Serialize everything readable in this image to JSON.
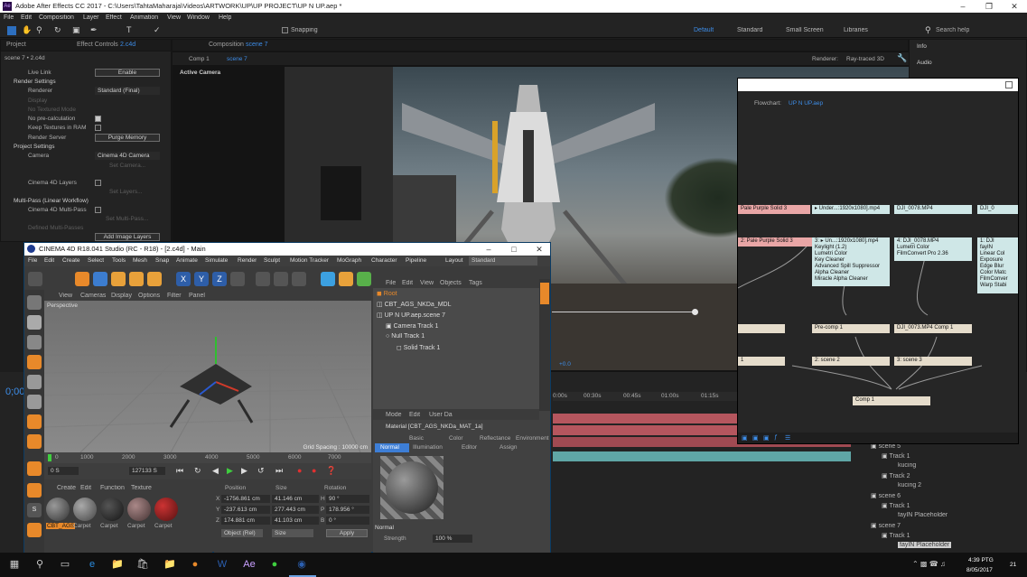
{
  "app": {
    "title": "Adobe After Effects CC 2017 - C:\\Users\\TahtaMaharaja\\Videos\\ARTWORK\\UP\\UP PROJECT\\UP N UP.aep *",
    "menu": [
      "File",
      "Edit",
      "Composition",
      "Layer",
      "Effect",
      "Animation",
      "View",
      "Window",
      "Help"
    ],
    "snapping": "Snapping",
    "workspaces": [
      "Default",
      "Standard",
      "Small Screen",
      "Libraries"
    ],
    "search_placeholder": "Search help"
  },
  "left_panel": {
    "tab_project": "Project",
    "tab_effect": "Effect Controls",
    "effect_target": "2.c4d",
    "breadcrumb": "scene 7 • 2.c4d",
    "live_link": "Live Link",
    "enable": "Enable",
    "render_settings": "Render Settings",
    "renderer": "Renderer",
    "renderer_value": "Standard (Final)",
    "display": "Display",
    "no_textured": "No Textured Mode",
    "no_precalc": "No pre-calculation",
    "keep_textures": "Keep Textures in RAM",
    "render_server": "Render Server",
    "purge_memory": "Purge Memory",
    "project_settings": "Project Settings",
    "camera": "Camera",
    "camera_value": "Cinema 4D Camera",
    "set_camera": "Set Camera...",
    "set_layers": "Set Layers...",
    "c4d_layers": "Cinema 4D Layers",
    "multipass": "Multi-Pass (Linear Workflow)",
    "c4d_multipass": "Cinema 4D Multi-Pass",
    "set_multipass": "Set Multi-Pass...",
    "defined_multipass": "Defined Multi-Passes",
    "add_image_layers": "Add Image Layers"
  },
  "composition": {
    "tab": "Composition",
    "tab_target": "scene 7",
    "breadcrumb_1": "Comp 1",
    "breadcrumb_2": "scene 7",
    "active_camera": "Active Camera",
    "renderer_label": "Renderer:",
    "renderer_value": "Ray-traced 3D"
  },
  "right_panel": {
    "info": "Info",
    "audio": "Audio"
  },
  "flowchart": {
    "title": "Flowchart:",
    "title_target": "UP N UP.aep",
    "nodes": {
      "pale_purple_a": "Pale Purple Solid 3",
      "pale_purple_b": "2: Pale Purple Solid 3",
      "under_mp4": "▸ Under...:1920x1080].mp4",
      "dji_0078": "DJI_0078.MP4",
      "dji_cut": "DJI_0",
      "under_3": "3: ▸ Un...:1920x1080].mp4",
      "under_3_fx": [
        "Keylight (1.2)",
        "Lumetri Color",
        "Key Cleaner",
        "Advanced Spill Suppressor",
        "Alpha Cleaner",
        "Miracle Alpha Cleaner"
      ],
      "dji4": "4: DJI_0078.MP4",
      "dji4_fx": [
        "Lumetri Color",
        "FilmConvert Pro 2.36"
      ],
      "fay": "1: DJI",
      "fay_fx": [
        "fayIN",
        "Linear Col",
        "Exposure",
        "Edge Blur",
        "Color Matc",
        "FilmConver",
        "Warp Stabi"
      ],
      "precomp": "Pre-comp 1",
      "dji_comp": "DJI_0073.MP4 Comp 1",
      "scene2": "2: scene 2",
      "scene3": "3: scene 3",
      "comp1": "Comp 1",
      "left_1": "1"
    }
  },
  "c4d": {
    "title": "CINEMA 4D R18.041 Studio (RC - R18) - [2.c4d] - Main",
    "menu": [
      "File",
      "Edit",
      "Create",
      "Select",
      "Tools",
      "Mesh",
      "Snap",
      "Animate",
      "Simulate",
      "Render",
      "Sculpt",
      "Motion Tracker",
      "MoGraph",
      "Character",
      "Pipeline",
      "Layout"
    ],
    "layout_value": "Standard",
    "viewport_menu": [
      "View",
      "Cameras",
      "Display",
      "Options",
      "Filter",
      "Panel"
    ],
    "perspective": "Perspective",
    "grid_spacing": "Grid Spacing : 10000 cm",
    "om_menu": [
      "File",
      "Edit",
      "View",
      "Objects",
      "Tags"
    ],
    "objects": [
      "Root",
      "CBT_AGS_NKDa_MDL",
      "UP N UP.aep.scene 7",
      "Camera Track 1",
      "Null Track 1",
      "Solid Track 1"
    ],
    "side_tabs": [
      "Objects",
      "Takes",
      "Content Browser",
      "Structure",
      "Attributes",
      "Layers"
    ],
    "attr_menu": [
      "Mode",
      "Edit",
      "User Da"
    ],
    "material_title": "Material [CBT_AGS_NKDa_MAT_1a]",
    "attr_tabs_1": [
      "Basic",
      "Color",
      "Reflectance",
      "Environment"
    ],
    "attr_tabs_2": [
      "Normal",
      "Illumination",
      "Editor",
      "Assign"
    ],
    "normal": "Normal",
    "strength": "Strength",
    "strength_value": "100 %",
    "timeline_ticks": [
      "0",
      "1000",
      "2000",
      "3000",
      "4000",
      "5000",
      "6000",
      "7000"
    ],
    "frame_start": "0 S",
    "frame_mid": "127133 S",
    "frame_right": "0 S",
    "mat_menu": [
      "Create",
      "Edit",
      "Function",
      "Texture"
    ],
    "materials": [
      "CBT_AGS",
      "Carpet",
      "Carpet",
      "Carpet",
      "Carpet"
    ],
    "coord_headers": [
      "Position",
      "Size",
      "Rotation"
    ],
    "coords": [
      {
        "axis": "X",
        "pos": "-1756.861 cm",
        "size": "41.146 cm",
        "rot_label": "H",
        "rot": "90 °"
      },
      {
        "axis": "Y",
        "pos": "-237.613 cm",
        "size": "277.443 cm",
        "rot_label": "P",
        "rot": "178.956 °"
      },
      {
        "axis": "Z",
        "pos": "174.881 cm",
        "size": "41.103 cm",
        "rot_label": "B",
        "rot": "0 °"
      }
    ],
    "coord_mode": "Object (Rel)",
    "size_mode": "Size",
    "apply": "Apply"
  },
  "timeline": {
    "ticks": [
      "0:00s",
      "00:30s",
      "00:45s",
      "01:00s",
      "01:15s"
    ],
    "timecode": "0;00",
    "layers_tree": [
      {
        "label": "scene 5",
        "depth": 0
      },
      {
        "label": "Track 1",
        "depth": 1
      },
      {
        "label": "kucing",
        "depth": 2
      },
      {
        "label": "Track 2",
        "depth": 1
      },
      {
        "label": "kucing 2",
        "depth": 2
      },
      {
        "label": "scene 6",
        "depth": 0
      },
      {
        "label": "Track 1",
        "depth": 1
      },
      {
        "label": "fayIN Placeholder",
        "depth": 2
      },
      {
        "label": "scene 7",
        "depth": 0
      },
      {
        "label": "Track 1",
        "depth": 1
      },
      {
        "label": "fayIN Placeholder",
        "depth": 2
      }
    ],
    "value_readout": "+0.0"
  },
  "taskbar": {
    "time": "4:39 PTG",
    "date": "8/05/2017",
    "badge": "21"
  }
}
